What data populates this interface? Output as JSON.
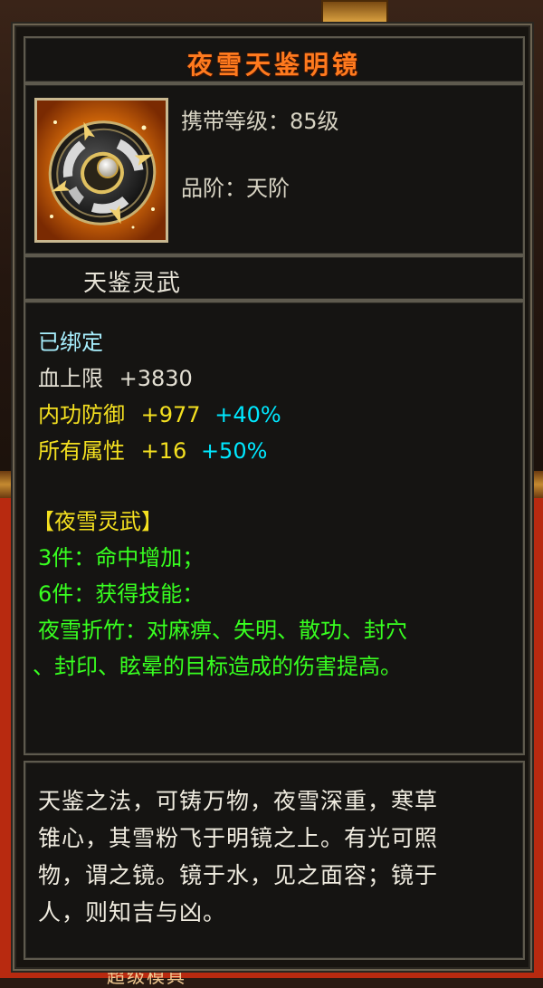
{
  "item": {
    "name": "夜雪天鉴明镜",
    "level_label": "携带等级：85级",
    "grade_label": "品阶：天阶",
    "subtype": "天鉴灵武"
  },
  "attributes": {
    "bound": "已绑定",
    "hp_label": "血上限",
    "hp_value": "+3830",
    "def_label": "内功防御",
    "def_value": "+977",
    "def_bonus": "+40%",
    "all_label": "所有属性",
    "all_value": "+16",
    "all_bonus": "+50%"
  },
  "set": {
    "name": "【夜雪灵武】",
    "bonus3": "3件：命中增加；",
    "bonus6": "6件：获得技能：",
    "skill_line1": "夜雪折竹：对麻痹、失明、散功、封穴",
    "skill_line2": "、封印、眩晕的目标造成的伤害提高。"
  },
  "description": {
    "line1": "天鉴之法，可铸万物，夜雪深重，寒草",
    "line2": "锥心，其雪粉飞于明镜之上。有光可照",
    "line3": "物，谓之镜。镜于水，见之面容；镜于",
    "line4": "人，则知吉与凶。"
  },
  "background": {
    "bottom_text": "超级模具"
  },
  "colors": {
    "title": "#ff7a1e",
    "bound": "#a8f0ff",
    "attr_yellow": "#f4e020",
    "bonus_cyan": "#00e8ff",
    "set_green": "#38ff20"
  },
  "icons": {
    "item_icon": "mirror-disc-icon"
  }
}
